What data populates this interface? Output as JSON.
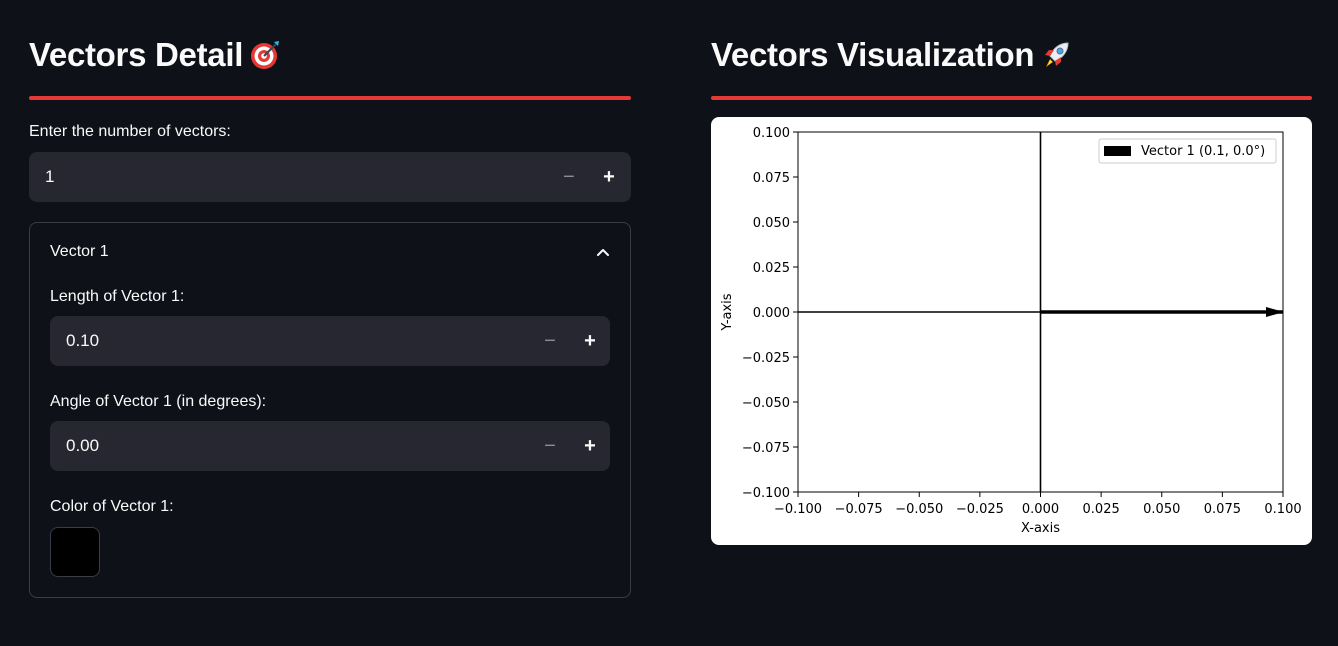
{
  "left": {
    "title": "Vectors Detail",
    "title_emoji": "dart-target-icon",
    "num_vectors_label": "Enter the number of vectors:",
    "num_vectors_value": "1",
    "expander": {
      "title": "Vector 1",
      "length_label": "Length of Vector 1:",
      "length_value": "0.10",
      "angle_label": "Angle of Vector 1 (in degrees):",
      "angle_value": "0.00",
      "color_label": "Color of Vector 1:",
      "color_value": "#000000"
    }
  },
  "right": {
    "title": "Vectors Visualization",
    "title_emoji": "rocket-icon"
  },
  "steppers": {
    "minus": "−",
    "plus": "+"
  },
  "colors": {
    "background": "#0e1117",
    "accent": "#e53935",
    "input_bg": "#262730"
  },
  "chart_data": {
    "type": "line",
    "xlabel": "X-axis",
    "ylabel": "Y-axis",
    "xlim": [
      -0.1,
      0.1
    ],
    "ylim": [
      -0.1,
      0.1
    ],
    "xticks": [
      -0.1,
      -0.075,
      -0.05,
      -0.025,
      0.0,
      0.025,
      0.05,
      0.075,
      0.1
    ],
    "xtick_labels": [
      "−0.100",
      "−0.075",
      "−0.050",
      "−0.025",
      "0.000",
      "0.025",
      "0.050",
      "0.075",
      "0.100"
    ],
    "yticks": [
      0.1,
      0.075,
      0.05,
      0.025,
      0.0,
      -0.025,
      -0.05,
      -0.075,
      -0.1
    ],
    "ytick_labels": [
      "0.100",
      "0.075",
      "0.050",
      "0.025",
      "0.000",
      "−0.025",
      "−0.050",
      "−0.075",
      "−0.100"
    ],
    "axis_lines": {
      "x": 0,
      "y": 0
    },
    "grid": false,
    "legend_position": "top-right",
    "vectors": [
      {
        "name": "Vector 1 (0.1, 0.0°)",
        "length": 0.1,
        "angle_deg": 0.0,
        "color": "#000000"
      }
    ]
  }
}
